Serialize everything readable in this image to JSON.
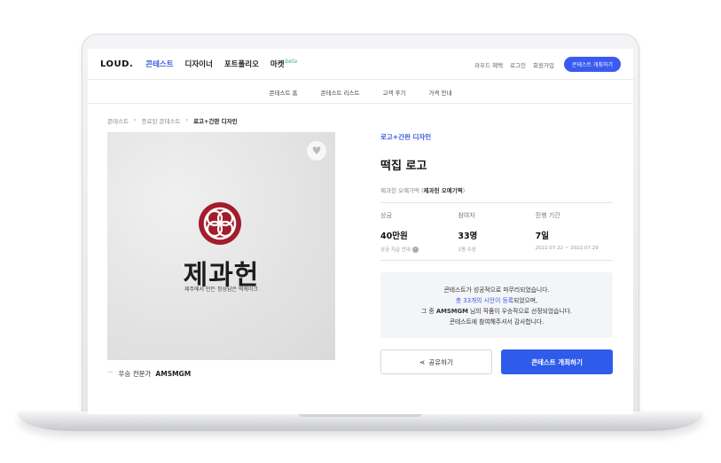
{
  "header": {
    "logo": "LOUD.",
    "nav": [
      "콘테스트",
      "디자이너",
      "포트폴리오",
      "마켓"
    ],
    "beta": "beta",
    "right_links": [
      "라우드 혜택",
      "로그인",
      "회원가입"
    ],
    "cta": "콘테스트 개최하기"
  },
  "subnav": [
    "콘테스트 홈",
    "콘테스트 리스트",
    "고객 후기",
    "가격 안내"
  ],
  "breadcrumb": [
    "콘테스트",
    "종료된 콘테스트",
    "로고+간판 디자인"
  ],
  "image": {
    "brand_text": "제과헌",
    "brand_sub": "제주에서 만든 정성담은 떡케이크"
  },
  "winner": {
    "label": "우승 전문가",
    "name": "AMSMGM"
  },
  "contest": {
    "category": "로고+간판 디자인",
    "title": "떡집 로고",
    "owner_prefix": "제과헌 오예가떡",
    "owner_name": "제과헌 오예기떡"
  },
  "stats": [
    {
      "label": "상금",
      "value": "40만원",
      "sub": "상금 지급 안내"
    },
    {
      "label": "참여자",
      "value": "33명",
      "sub": "1명 수상"
    },
    {
      "label": "진행 기간",
      "value": "7일",
      "sub": "2022.07.22 ~ 2022.07.29"
    }
  ],
  "notice": {
    "line1": "콘테스트가 성공적으로 마무리되었습니다.",
    "line2_hl": "총 33개의 시안이 등록",
    "line2_rest": "되었으며,",
    "line3_pre": "그 중",
    "line3_name": "AMSMGM",
    "line3_rest": "님의 작품이 우승작으로 선정되었습니다.",
    "line4": "콘테스트에 참여해주셔서 감사합니다."
  },
  "buttons": {
    "share": "공유하기",
    "host": "콘테스트 개최하기"
  },
  "colors": {
    "accent": "#2f5bea",
    "emblem": "#a11d2b"
  }
}
